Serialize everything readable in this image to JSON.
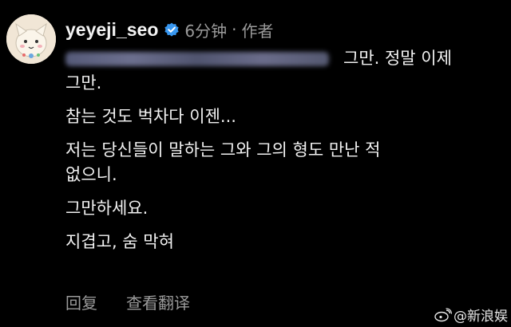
{
  "comment": {
    "username": "yeyeji_seo",
    "time": "6分钟",
    "separator": "·",
    "role": "作者",
    "mention_tag": "@blurred_username",
    "lines": [
      "그만. 정말 이제",
      "그만.",
      "참는 것도 벅차다 이젠...",
      "저는 당신들이 말하는 그와 그의 형도 만난 적",
      "없으니.",
      "그만하세요.",
      "지겹고, 숨 막혀"
    ],
    "reply_label": "回复",
    "translate_label": "查看翻译"
  },
  "watermark": {
    "text": "@新浪娱"
  },
  "colors": {
    "background": "#000000",
    "text": "#f2f2f2",
    "muted": "#9a9a9a",
    "verified": "#3897f0"
  }
}
